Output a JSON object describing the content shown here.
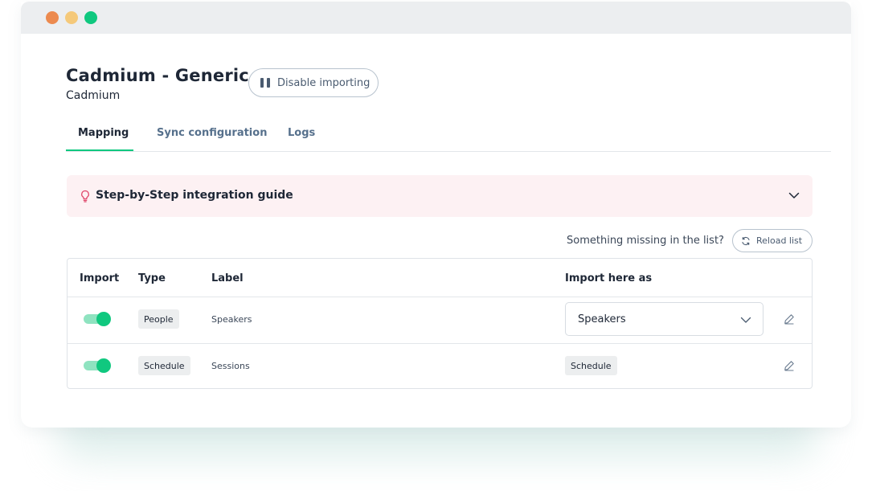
{
  "header": {
    "title": "Cadmium - Generic",
    "subtitle": "Cadmium",
    "disable_label": "Disable importing"
  },
  "tabs": [
    {
      "label": "Mapping",
      "active": true
    },
    {
      "label": "Sync configuration",
      "active": false
    },
    {
      "label": "Logs",
      "active": false
    }
  ],
  "guide": {
    "title": "Step-by-Step integration guide",
    "icon": "lightbulb-icon"
  },
  "toolbar": {
    "missing_text": "Something missing in the list?",
    "reload_label": "Reload list"
  },
  "table": {
    "columns": [
      "Import",
      "Type",
      "Label",
      "Import here as"
    ],
    "rows": [
      {
        "import_enabled": true,
        "type": "People",
        "label": "Speakers",
        "import_as": "Speakers",
        "import_as_kind": "select"
      },
      {
        "import_enabled": true,
        "type": "Schedule",
        "label": "Sessions",
        "import_as": "Schedule",
        "import_as_kind": "chip"
      }
    ]
  },
  "colors": {
    "accent": "#10c87f",
    "guide_bg": "#fdf1f3",
    "window_dots": [
      "#ec8a4f",
      "#f5c97a",
      "#10c87f"
    ]
  }
}
